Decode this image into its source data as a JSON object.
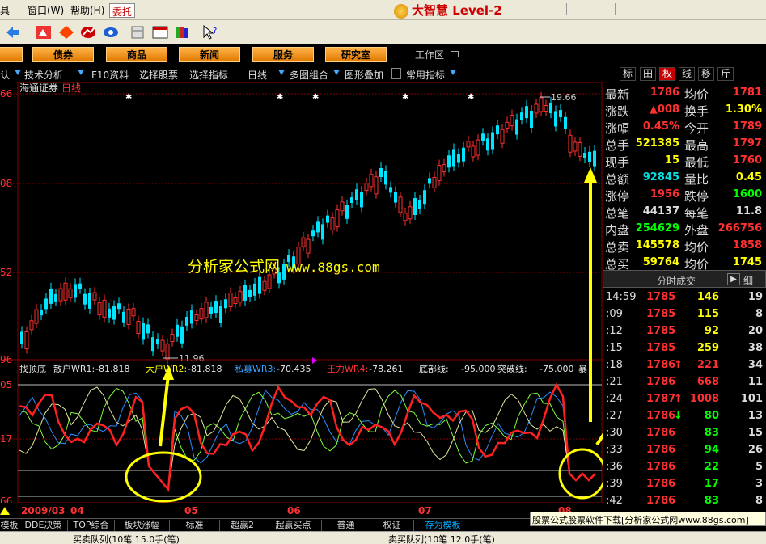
{
  "menu": {
    "items": [
      "具",
      "窗口(W)",
      "帮助(H)"
    ],
    "trade_label": "委托",
    "brand_title": "大智慧 Level-2"
  },
  "nav": {
    "buttons": [
      "债券",
      "商品",
      "新闻",
      "服务",
      "研究室"
    ],
    "workarea": "工作区"
  },
  "funcbar": {
    "items": [
      "认",
      "技术分析",
      "F10资料",
      "选择股票",
      "选择指标",
      "日线",
      "多图组合",
      "图形叠加",
      "常用指标"
    ]
  },
  "right_tabs": [
    "标",
    "田",
    "权",
    "线",
    "移",
    "斤"
  ],
  "chart": {
    "title": "海通证券",
    "period": "日线",
    "high_label": "19.66",
    "low_label": "11.96",
    "y_ticks": [
      "66",
      "08",
      "52",
      "96"
    ],
    "indicator": {
      "name": "找顶底",
      "items": [
        {
          "label": "散户WR1:",
          "value": "-81.818",
          "color": "#e6e6e6"
        },
        {
          "label": "大户WR2:",
          "value": "-81.818",
          "color": "#ffff00"
        },
        {
          "label": "私募WR3:",
          "value": "-70.435",
          "color": "#3aa0ff"
        },
        {
          "label": "王力WR4:",
          "value": "-78.261",
          "color": "#ff3030"
        },
        {
          "label": "底部线:",
          "value": "-95.000",
          "color": "#e6e6e6"
        },
        {
          "label": "突破线:",
          "value": "-75.000",
          "color": "#e6e6e6"
        },
        {
          "label": "暴",
          "value": "",
          "color": "#e6e6e6"
        }
      ],
      "y_ticks": [
        "05",
        "17",
        "66"
      ]
    },
    "dates": [
      "2009/03",
      "04",
      "05",
      "06",
      "07",
      "08"
    ],
    "watermark": "分析家公式网",
    "watermark_url": "www.88gs.com"
  },
  "quote": {
    "rows": [
      {
        "l1": "最新",
        "v1": "1786",
        "c1": "#ff3030",
        "l2": "均价",
        "v2": "1781",
        "c2": "#ff3030"
      },
      {
        "l1": "涨跌",
        "v1": "▲008",
        "c1": "#ff3030",
        "l2": "换手",
        "v2": "1.30%",
        "c2": "#ffff00"
      },
      {
        "l1": "涨幅",
        "v1": "0.45%",
        "c1": "#ff3030",
        "l2": "今开",
        "v2": "1789",
        "c2": "#ff3030"
      },
      {
        "l1": "总手",
        "v1": "521385",
        "c1": "#ffff00",
        "l2": "最高",
        "v2": "1797",
        "c2": "#ff3030"
      },
      {
        "l1": "现手",
        "v1": "15",
        "c1": "#ffff00",
        "l2": "最低",
        "v2": "1760",
        "c2": "#ff3030"
      },
      {
        "l1": "总额",
        "v1": "92845",
        "c1": "#00e0e0",
        "l2": "量比",
        "v2": "0.45",
        "c2": "#ffff00"
      },
      {
        "l1": "涨停",
        "v1": "1956",
        "c1": "#ff3030",
        "l2": "跌停",
        "v2": "1600",
        "c2": "#00ff00"
      },
      {
        "l1": "总笔",
        "v1": "44137",
        "c1": "#dddddd",
        "l2": "每笔",
        "v2": "11.8",
        "c2": "#dddddd"
      },
      {
        "l1": "内盘",
        "v1": "254629",
        "c1": "#00ff00",
        "l2": "外盘",
        "v2": "266756",
        "c2": "#ff3030"
      },
      {
        "l1": "总卖",
        "v1": "145578",
        "c1": "#ffff00",
        "l2": "均价",
        "v2": "1858",
        "c2": "#ff3030"
      },
      {
        "l1": "总买",
        "v1": "59764",
        "c1": "#ffff00",
        "l2": "均价",
        "v2": "1745",
        "c2": "#ffff00"
      }
    ],
    "tick_header": "分时成交",
    "tick_detail": "细"
  },
  "ticks": [
    {
      "time": "14:59",
      "price": "1785",
      "pc": "#ff3030",
      "arrow": "",
      "ac": "",
      "vol": "146",
      "vc": "#ffff00",
      "num": "19"
    },
    {
      "time": ":09",
      "price": "1785",
      "pc": "#ff3030",
      "arrow": "",
      "ac": "",
      "vol": "115",
      "vc": "#ffff00",
      "num": "8"
    },
    {
      "time": ":12",
      "price": "1785",
      "pc": "#ff3030",
      "arrow": "",
      "ac": "",
      "vol": "92",
      "vc": "#ffff00",
      "num": "20"
    },
    {
      "time": ":15",
      "price": "1785",
      "pc": "#ff3030",
      "arrow": "",
      "ac": "",
      "vol": "259",
      "vc": "#ffff00",
      "num": "38"
    },
    {
      "time": ":18",
      "price": "1786",
      "pc": "#ff3030",
      "arrow": "↑",
      "ac": "#ff3030",
      "vol": "221",
      "vc": "#ff3030",
      "num": "34"
    },
    {
      "time": ":21",
      "price": "1786",
      "pc": "#ff3030",
      "arrow": "",
      "ac": "",
      "vol": "668",
      "vc": "#ff3030",
      "num": "11"
    },
    {
      "time": ":24",
      "price": "1787",
      "pc": "#ff3030",
      "arrow": "↑",
      "ac": "#ff3030",
      "vol": "1008",
      "vc": "#ff3030",
      "num": "101"
    },
    {
      "time": ":27",
      "price": "1786",
      "pc": "#ff3030",
      "arrow": "↓",
      "ac": "#00ff00",
      "vol": "80",
      "vc": "#00ff00",
      "num": "13"
    },
    {
      "time": ":30",
      "price": "1786",
      "pc": "#ff3030",
      "arrow": "",
      "ac": "",
      "vol": "83",
      "vc": "#00ff00",
      "num": "15"
    },
    {
      "time": ":33",
      "price": "1786",
      "pc": "#ff3030",
      "arrow": "",
      "ac": "",
      "vol": "94",
      "vc": "#00ff00",
      "num": "26"
    },
    {
      "time": ":36",
      "price": "1786",
      "pc": "#ff3030",
      "arrow": "",
      "ac": "",
      "vol": "22",
      "vc": "#00ff00",
      "num": "5"
    },
    {
      "time": ":39",
      "price": "1786",
      "pc": "#ff3030",
      "arrow": "",
      "ac": "",
      "vol": "17",
      "vc": "#00ff00",
      "num": "3"
    },
    {
      "time": ":42",
      "price": "1786",
      "pc": "#ff3030",
      "arrow": "",
      "ac": "",
      "vol": "83",
      "vc": "#00ff00",
      "num": "8"
    }
  ],
  "bottom_tabs": [
    {
      "label": "模板",
      "on": false
    },
    {
      "label": "DDE决策",
      "on": false
    },
    {
      "label": "TOP综合",
      "on": false
    },
    {
      "label": "板块涨幅",
      "on": false
    },
    {
      "label": "标准",
      "on": false
    },
    {
      "label": "超赢2",
      "on": false
    },
    {
      "label": "超赢买点",
      "on": false
    },
    {
      "label": "普通",
      "on": false
    },
    {
      "label": "权证",
      "on": false
    },
    {
      "label": "存为模板",
      "on": true
    }
  ],
  "banner": "股票公式股票软件下载[分析家公式网www.88gs.com]",
  "status": {
    "left": "买卖队列(10笔 15.0手(笔)",
    "right": "卖买队列(10笔 12.0手(笔)"
  }
}
